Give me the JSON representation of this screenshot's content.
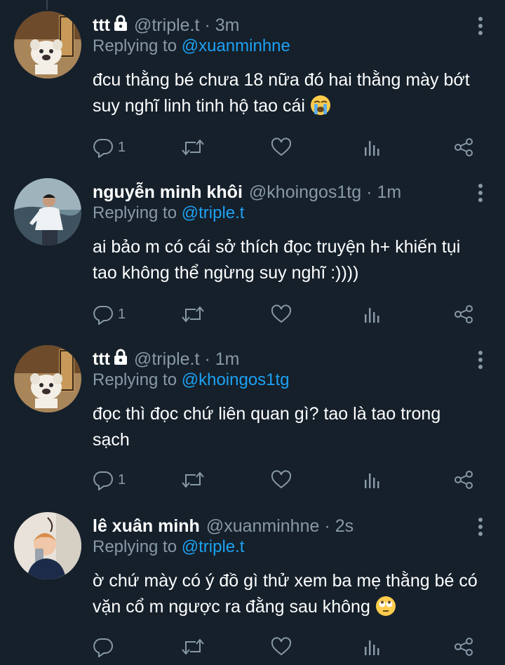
{
  "tweets": [
    {
      "name": "ttt",
      "handle": "@triple.t",
      "time": "3m",
      "replying_prefix": "Replying to",
      "replying_to": "@xuanminhne",
      "lines": [
        "đcu thằng bé chưa 18 nữa đó hai thằng mày bớt",
        "suy nghĩ linh tinh hộ tao cái"
      ],
      "emoji": "loudly-crying-face",
      "reply_count": "1",
      "locked": true
    },
    {
      "name": "nguyễn minh khôi",
      "handle": "@khoingos1tg",
      "time": "1m",
      "replying_prefix": "Replying to",
      "replying_to": "@triple.t",
      "lines": [
        "ai bảo m có cái sở thích đọc truyện h+ khiến tụi",
        "tao không thể ngừng suy nghĩ :))))"
      ],
      "emoji": "",
      "reply_count": "1",
      "locked": false
    },
    {
      "name": "ttt",
      "handle": "@triple.t",
      "time": "1m",
      "replying_prefix": "Replying to",
      "replying_to": "@khoingos1tg",
      "lines": [
        "đọc thì đọc chứ liên quan gì? tao là tao trong",
        "sạch"
      ],
      "emoji": "",
      "reply_count": "1",
      "locked": true
    },
    {
      "name": "lê xuân minh",
      "handle": "@xuanminhne",
      "time": "2s",
      "replying_prefix": "Replying to",
      "replying_to": "@triple.t",
      "lines": [
        "ờ chứ mày có ý đồ gì thử xem ba mẹ thằng bé có",
        "vặn cổ m ngược ra đằng sau không"
      ],
      "emoji": "face-with-rolling-eyes",
      "reply_count": "",
      "locked": false
    }
  ],
  "colors": {
    "background": "#15202b",
    "text": "#ffffff",
    "secondary": "#8899a6",
    "link": "#1da1f2",
    "divider": "#38444d"
  },
  "icons": [
    "comment-icon",
    "retweet-icon",
    "heart-icon",
    "analytics-icon",
    "share-icon",
    "more-icon",
    "lock-icon"
  ]
}
